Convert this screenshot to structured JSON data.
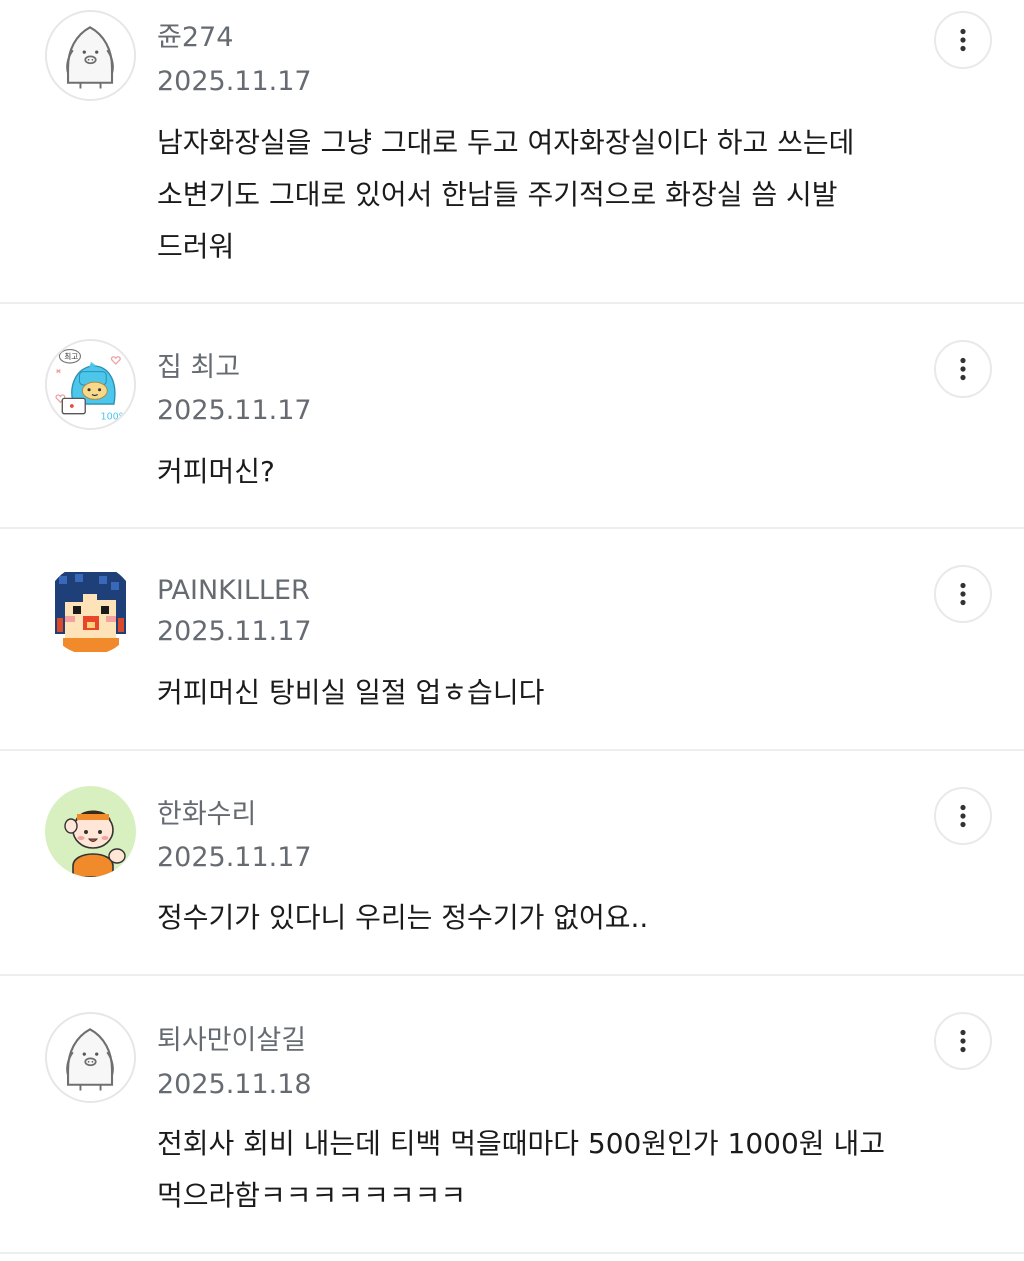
{
  "comments": [
    {
      "avatar_icon": "penguin-default-avatar-icon",
      "username": "쥰274",
      "date": "2025.11.17",
      "lines": [
        "남자화장실을 그냥 그대로 두고 여자화장실이다 하고 쓰는데",
        "소변기도 그대로 있어서 한남들 주기적으로 화장실 씀 시발",
        "드러워"
      ]
    },
    {
      "avatar_icon": "blue-character-avatar-icon",
      "username": "집 최고",
      "date": "2025.11.17",
      "lines": [
        "커피머신?"
      ]
    },
    {
      "avatar_icon": "pixel-girl-avatar-icon",
      "username": "PAINKILLER",
      "date": "2025.11.17",
      "lines": [
        "커피머신 탕비실 일절 업ㅎ습니다"
      ]
    },
    {
      "avatar_icon": "orange-mascot-avatar-icon",
      "username": "한화수리",
      "date": "2025.11.17",
      "lines": [
        "정수기가 있다니 우리는 정수기가 없어요.."
      ]
    },
    {
      "avatar_icon": "penguin-default-avatar-icon",
      "username": "퇴사만이살길",
      "date": "2025.11.18",
      "lines": [
        "전회사 회비 내는데 티백 먹을때마다 500원인가 1000원 내고",
        "먹으라함ㅋㅋㅋㅋㅋㅋㅋㅋ"
      ]
    }
  ],
  "more_button_icon": "more-vertical-icon"
}
